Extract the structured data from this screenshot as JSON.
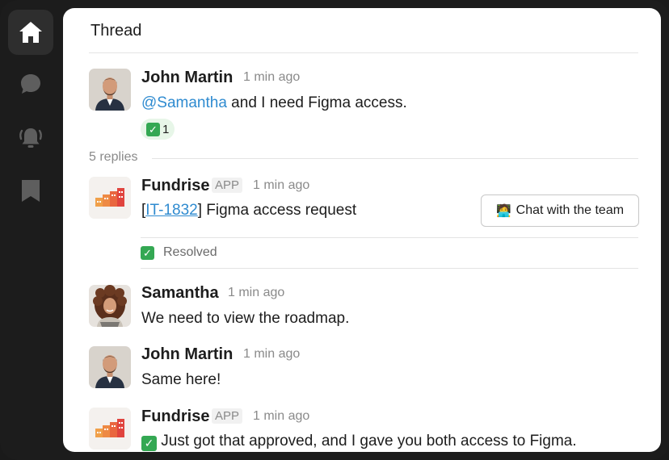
{
  "sidebar": {
    "items": [
      {
        "name": "home-icon",
        "active": true
      },
      {
        "name": "chat-bubble-icon",
        "active": false
      },
      {
        "name": "alarm-bell-icon",
        "active": false
      },
      {
        "name": "bookmark-icon",
        "active": false
      }
    ]
  },
  "thread": {
    "title": "Thread",
    "parent": {
      "author": "John Martin",
      "time": "1 min ago",
      "mention": "@Samantha",
      "text": " and I need Figma access.",
      "reaction_count": "1"
    },
    "replies_label": "5 replies",
    "messages": [
      {
        "author": "Fundrise",
        "tag": "APP",
        "time": "1 min ago",
        "ticket_open": "[",
        "ticket_id": "IT-1832",
        "ticket_close": "]",
        "text": " Figma access request",
        "button_emoji": "🧑‍💻",
        "button_label": "Chat with the team",
        "status": "Resolved"
      },
      {
        "author": "Samantha",
        "time": "1 min ago",
        "text": "We need to view the roadmap."
      },
      {
        "author": "John Martin",
        "time": "1 min ago",
        "text": "Same here!"
      },
      {
        "author": "Fundrise",
        "tag": "APP",
        "time": "1 min ago",
        "text": "Just got that approved, and I gave you both access to Figma."
      }
    ]
  },
  "colors": {
    "sidebar_bg": "#1c1c1c",
    "panel_bg": "#ffffff",
    "link": "#2f8bd0",
    "check_green": "#34a853",
    "fundrise_orange": "#f0a04a",
    "fundrise_red": "#e0443e"
  }
}
